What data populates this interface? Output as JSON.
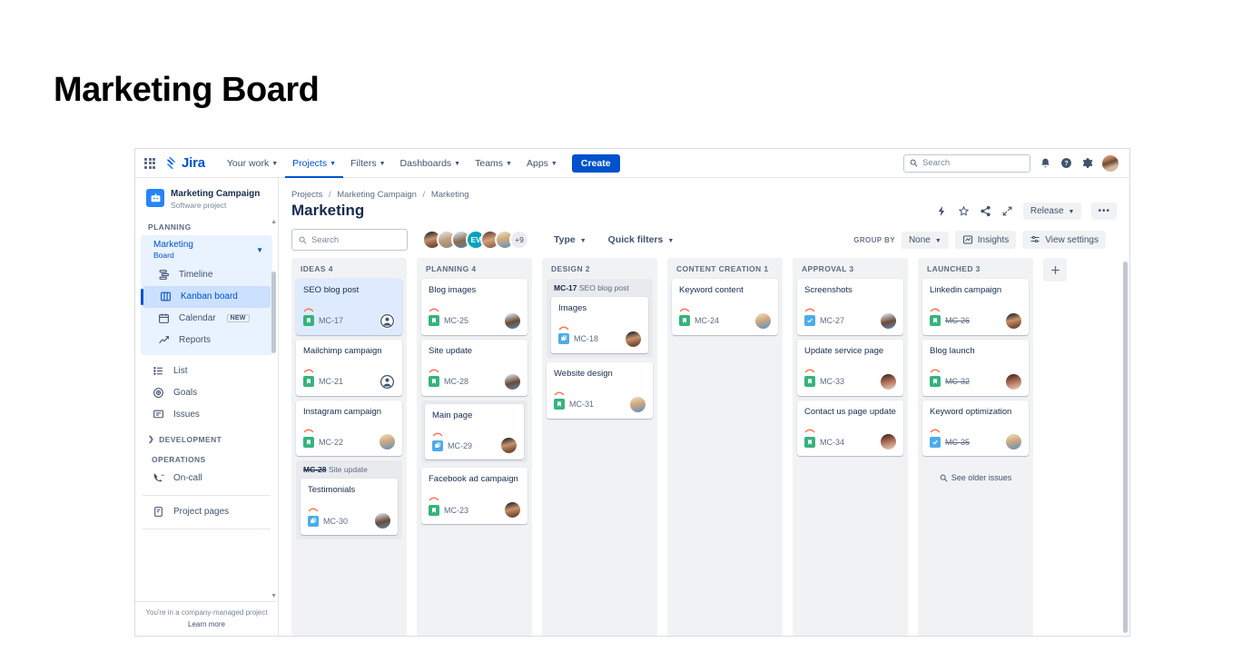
{
  "page": {
    "title": "Marketing Board"
  },
  "topnav": {
    "product": "Jira",
    "items": [
      {
        "label": "Your work",
        "has_caret": true,
        "active": false
      },
      {
        "label": "Projects",
        "has_caret": true,
        "active": true
      },
      {
        "label": "Filters",
        "has_caret": true,
        "active": false
      },
      {
        "label": "Dashboards",
        "has_caret": true,
        "active": false
      },
      {
        "label": "Teams",
        "has_caret": true,
        "active": false
      },
      {
        "label": "Apps",
        "has_caret": true,
        "active": false
      }
    ],
    "create_label": "Create",
    "search_placeholder": "Search",
    "icons": [
      "notifications-icon",
      "help-icon",
      "settings-icon",
      "profile-avatar"
    ]
  },
  "sidebar": {
    "project_name": "Marketing Campaign",
    "project_type": "Software project",
    "planning_label": "PLANNING",
    "board": {
      "name": "Marketing",
      "sub": "Board"
    },
    "planning_items": [
      {
        "label": "Timeline",
        "icon": "timeline-icon",
        "selected": false
      },
      {
        "label": "Kanban board",
        "icon": "board-icon",
        "selected": true
      },
      {
        "label": "Calendar",
        "icon": "calendar-icon",
        "selected": false,
        "badge": "NEW"
      },
      {
        "label": "Reports",
        "icon": "reports-icon",
        "selected": false
      }
    ],
    "general_items": [
      {
        "label": "List",
        "icon": "list-icon"
      },
      {
        "label": "Goals",
        "icon": "goals-icon"
      },
      {
        "label": "Issues",
        "icon": "issues-icon"
      }
    ],
    "development_label": "DEVELOPMENT",
    "operations_label": "OPERATIONS",
    "operations_items": [
      {
        "label": "On-call",
        "icon": "oncall-icon"
      }
    ],
    "pages_items": [
      {
        "label": "Project pages",
        "icon": "pages-icon"
      }
    ],
    "footer_note": "You're in a company-managed project",
    "footer_link": "Learn more"
  },
  "main": {
    "breadcrumb": [
      "Projects",
      "Marketing Campaign",
      "Marketing"
    ],
    "title": "Marketing",
    "title_icons": [
      "lightning-icon",
      "star-icon",
      "share-icon",
      "expand-icon"
    ],
    "release_label": "Release",
    "more_label": "•••",
    "toolbar": {
      "search_placeholder": "Search",
      "avatar_initials": "EV",
      "avatar_overflow": "+9",
      "type_label": "Type",
      "quick_filters_label": "Quick filters",
      "group_by_label": "GROUP BY",
      "group_by_value": "None",
      "insights_label": "Insights",
      "view_settings_label": "View settings"
    }
  },
  "board": {
    "add_column_label": "+",
    "see_older_label": "See older issues",
    "columns": [
      {
        "name": "IDEAS",
        "count": "4",
        "cards": [
          {
            "title": "SEO blog post",
            "key": "MC-17",
            "type": "story",
            "selected": true,
            "avatar": "anon",
            "done": false
          },
          {
            "title": "Mailchimp campaign",
            "key": "MC-21",
            "type": "story",
            "selected": false,
            "avatar": "anon",
            "done": false
          },
          {
            "title": "Instagram campaign",
            "key": "MC-22",
            "type": "story",
            "selected": false,
            "avatar": "photo-blonde",
            "done": false
          }
        ],
        "group": {
          "parent_key": "MC-28",
          "parent_title": "Site update",
          "parent_done": true,
          "cards": [
            {
              "title": "Testimonials",
              "key": "MC-30",
              "type": "subtask",
              "avatar": "photo-man-beard",
              "done": false
            }
          ]
        }
      },
      {
        "name": "PLANNING",
        "count": "4",
        "cards": [
          {
            "title": "Blog images",
            "key": "MC-25",
            "type": "story",
            "selected": false,
            "avatar": "photo-man-beard",
            "done": false
          },
          {
            "title": "Site update",
            "key": "MC-28",
            "type": "story",
            "selected": false,
            "avatar": "photo-man-beard",
            "done": false
          }
        ],
        "group_mid": {
          "cards": [
            {
              "title": "Main page",
              "key": "MC-29",
              "type": "subtask",
              "avatar": "photo-woman-dark",
              "done": false
            }
          ]
        },
        "cards_after": [
          {
            "title": "Facebook ad campaign",
            "key": "MC-23",
            "type": "story",
            "selected": false,
            "avatar": "photo-woman-dark",
            "done": false
          }
        ]
      },
      {
        "name": "DESIGN",
        "count": "2",
        "group_top": {
          "parent_key": "MC-17",
          "parent_title": "SEO blog post",
          "parent_done": false,
          "cards": [
            {
              "title": "Images",
              "key": "MC-18",
              "type": "subtask",
              "avatar": "photo-woman-dark",
              "done": false
            }
          ]
        },
        "cards": [
          {
            "title": "Website design",
            "key": "MC-31",
            "type": "story",
            "selected": false,
            "avatar": "photo-blonde",
            "done": false
          }
        ]
      },
      {
        "name": "CONTENT CREATION",
        "count": "1",
        "cards": [
          {
            "title": "Keyword content",
            "key": "MC-24",
            "type": "story",
            "selected": false,
            "avatar": "photo-blonde",
            "done": false
          }
        ]
      },
      {
        "name": "APPROVAL",
        "count": "3",
        "cards": [
          {
            "title": "Screenshots",
            "key": "MC-27",
            "type": "task",
            "selected": false,
            "avatar": "photo-man-beard",
            "done": false
          },
          {
            "title": "Update service page",
            "key": "MC-33",
            "type": "story",
            "selected": false,
            "avatar": "photo-woman-red",
            "done": false
          },
          {
            "title": "Contact us page update",
            "key": "MC-34",
            "type": "story",
            "selected": false,
            "avatar": "photo-woman-red",
            "done": false
          }
        ]
      },
      {
        "name": "LAUNCHED",
        "count": "3",
        "cards": [
          {
            "title": "Linkedin campaign",
            "key": "MC-26",
            "type": "story",
            "selected": false,
            "avatar": "photo-woman-dark",
            "done": true
          },
          {
            "title": "Blog launch",
            "key": "MC-32",
            "type": "story",
            "selected": false,
            "avatar": "photo-woman-red",
            "done": true
          },
          {
            "title": "Keyword optimization",
            "key": "MC-35",
            "type": "task",
            "selected": false,
            "avatar": "photo-blonde",
            "done": true
          }
        ],
        "has_see_older": true
      }
    ]
  },
  "colors": {
    "brand": "#0052cc",
    "selected_card": "#deebff",
    "story": "#36b37e",
    "subtask": "#4bade8",
    "priority": "#ff7452"
  }
}
